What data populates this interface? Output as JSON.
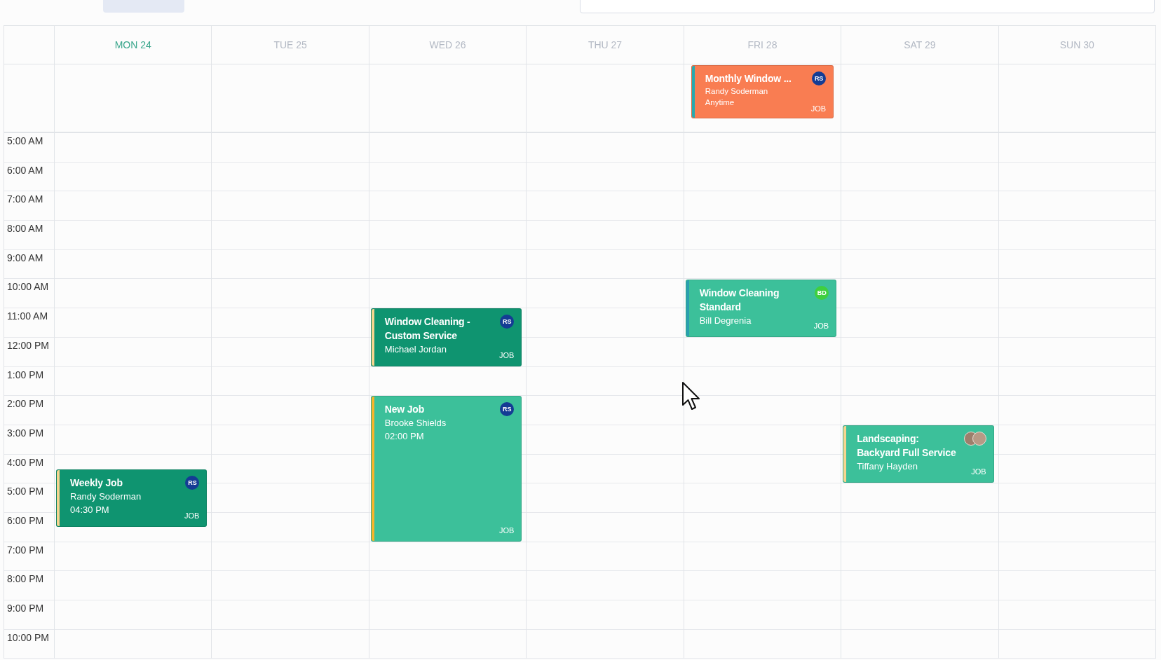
{
  "days": [
    {
      "label": "MON 24",
      "today": true,
      "events": [
        {
          "title": "Weekly Job",
          "lines": [
            "Randy Soderman",
            "04:30 PM"
          ],
          "tag": "JOB",
          "color": "#0f9470",
          "stripe": {
            "color": "#f6d58f"
          },
          "avatars": [
            {
              "kind": "initials",
              "text": "RS",
              "color": "#143c94"
            }
          ]
        }
      ]
    },
    {
      "label": "TUE 25",
      "today": false
    },
    {
      "label": "WED 26",
      "today": false,
      "events": [
        {
          "title": "Window Cleaning - Custom Service",
          "lines": [
            "Michael Jordan"
          ],
          "tag": "JOB",
          "color": "#0f9470",
          "stripe": {
            "color": "#f6d58f"
          },
          "avatars": [
            {
              "kind": "initials",
              "text": "RS",
              "color": "#143c94"
            }
          ]
        },
        {
          "title": "New Job",
          "lines": [
            "Brooke Shields",
            "02:00 PM"
          ],
          "tag": "JOB",
          "color": "#3cc09a",
          "stripe": {
            "color": "#f6b52a"
          },
          "avatars": [
            {
              "kind": "initials",
              "text": "RS",
              "color": "#143c94"
            }
          ]
        }
      ]
    },
    {
      "label": "THU 27",
      "today": false
    },
    {
      "label": "FRI 28",
      "today": false,
      "all_day": [
        {
          "title": "Monthly Window ...",
          "lines": [
            "Randy Soderman",
            "Anytime"
          ],
          "tag": "JOB",
          "color": "#f97d52",
          "stripe": {
            "color": "#26aab0"
          },
          "avatars": [
            {
              "kind": "initials",
              "text": "RS",
              "color": "#143c94"
            }
          ]
        }
      ],
      "events": [
        {
          "title": "Window Cleaning Standard",
          "lines": [
            "Bill Degrenia"
          ],
          "tag": "JOB",
          "color": "#3cc09a",
          "stripe": {
            "color": "#2a9fb0"
          },
          "avatars": [
            {
              "kind": "initials",
              "text": "BD",
              "color": "#3fcf3f"
            }
          ]
        }
      ]
    },
    {
      "label": "SAT 29",
      "today": false,
      "events": [
        {
          "title": "Landscaping: Backyard Full Service",
          "lines": [
            "Tiffany Hayden"
          ],
          "tag": "JOB",
          "color": "#3cc09a",
          "stripe": {
            "color": "#f6d58f"
          },
          "avatars": [
            {
              "kind": "photo"
            },
            {
              "kind": "photo"
            }
          ]
        }
      ]
    },
    {
      "label": "SUN 30",
      "today": false
    }
  ],
  "hours": [
    "5:00 AM",
    "6:00 AM",
    "7:00 AM",
    "8:00 AM",
    "9:00 AM",
    "10:00 AM",
    "11:00 AM",
    "12:00 PM",
    "1:00 PM",
    "2:00 PM",
    "3:00 PM",
    "4:00 PM",
    "5:00 PM",
    "6:00 PM",
    "7:00 PM",
    "8:00 PM",
    "9:00 PM",
    "10:00 PM"
  ]
}
